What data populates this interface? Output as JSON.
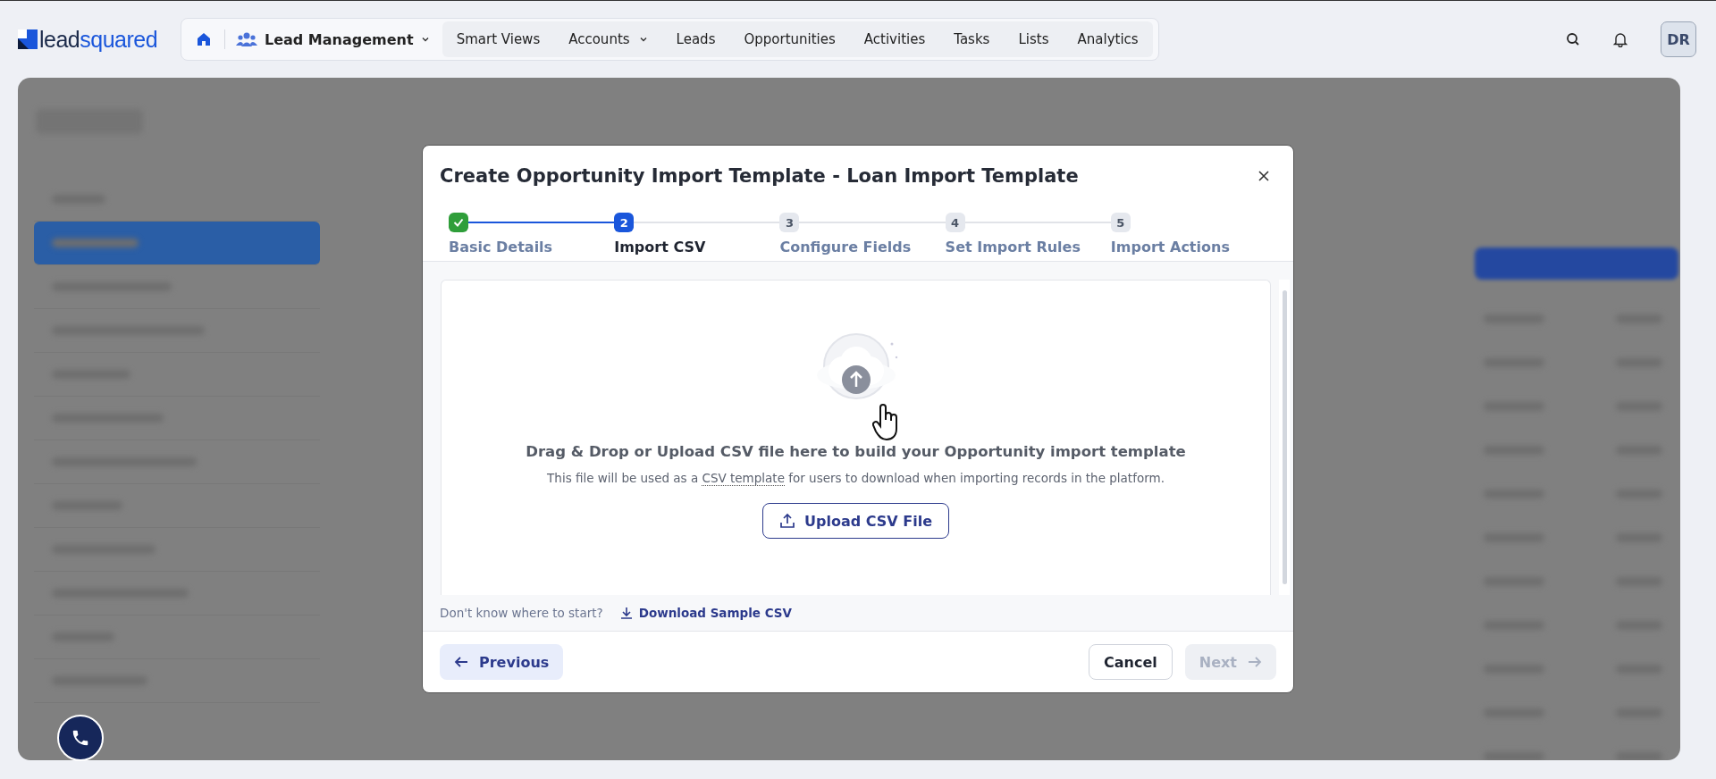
{
  "header": {
    "logo": {
      "part1": "lead",
      "part2": "squared"
    },
    "module": "Lead Management",
    "nav": [
      {
        "label": "Smart Views",
        "dropdown": false
      },
      {
        "label": "Accounts",
        "dropdown": true
      },
      {
        "label": "Leads",
        "dropdown": false
      },
      {
        "label": "Opportunities",
        "dropdown": false
      },
      {
        "label": "Activities",
        "dropdown": false
      },
      {
        "label": "Tasks",
        "dropdown": false
      },
      {
        "label": "Lists",
        "dropdown": false
      },
      {
        "label": "Analytics",
        "dropdown": false
      }
    ],
    "avatar": "DR"
  },
  "dialog": {
    "title": "Create Opportunity Import Template - Loan Import Template",
    "steps": [
      {
        "label": "Basic Details",
        "done": true,
        "selected": false
      },
      {
        "number": "2",
        "label": "Import CSV",
        "done": false,
        "selected": true
      },
      {
        "number": "3",
        "label": "Configure Fields",
        "done": false,
        "selected": false
      },
      {
        "number": "4",
        "label": "Set Import Rules",
        "done": false,
        "selected": false
      },
      {
        "number": "5",
        "label": "Import Actions",
        "done": false,
        "selected": false
      }
    ],
    "drop_zone": {
      "heading": "Drag & Drop or Upload CSV file here to build your Opportunity import template",
      "note_before": "This file will be used as a",
      "note_term": "CSV template",
      "note_after": "for users to download when importing records in the platform.",
      "button": "Upload CSV File"
    },
    "hint": "Don't know where to start?",
    "sample_link": "Download Sample CSV",
    "buttons": [
      {
        "label": "Previous",
        "kind": "back",
        "disabled": false
      },
      {
        "label": "Cancel",
        "kind": "plain",
        "disabled": false
      },
      {
        "label": "Next",
        "kind": "forward",
        "disabled": true
      }
    ]
  }
}
